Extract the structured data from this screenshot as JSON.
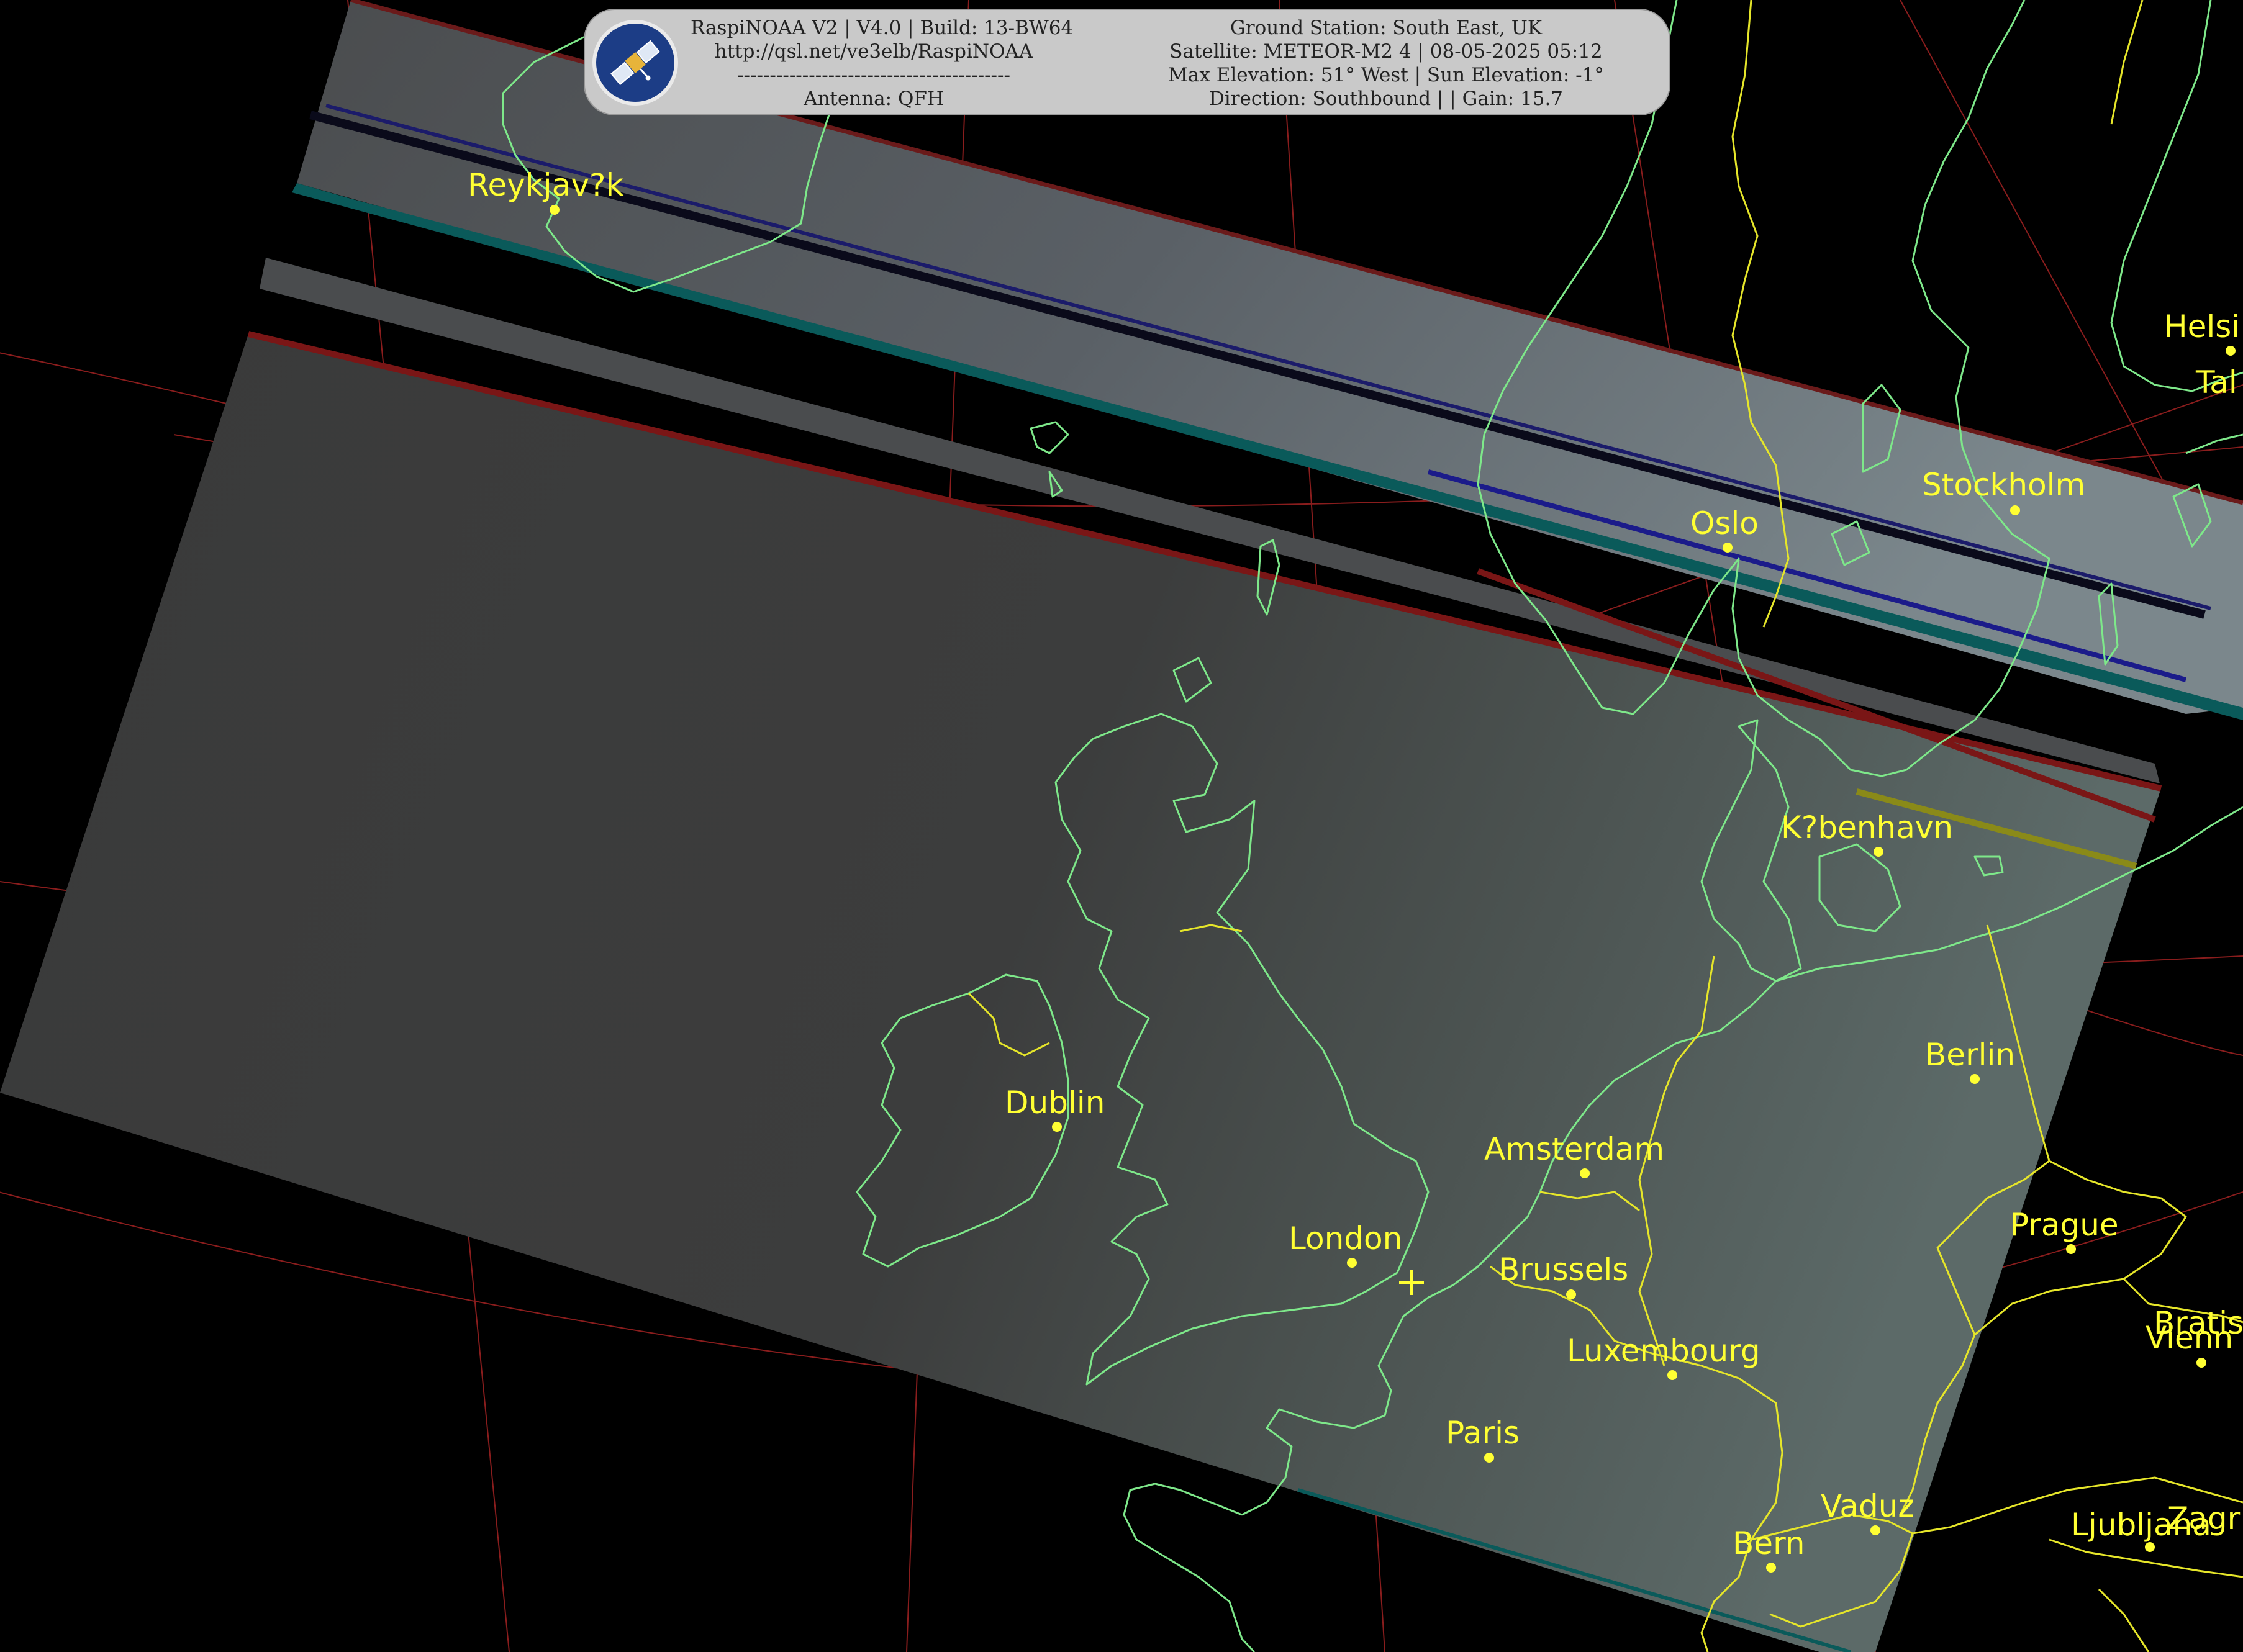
{
  "header": {
    "line1_left": "RaspiNOAA V2 | V4.0 | Build: 13-BW64",
    "line2_left": "http://qsl.net/ve3elb/RaspiNOAA",
    "line3_left": "------------------------------------------",
    "line4_left": "Antenna: QFH",
    "line1_right": "Ground Station: South East, UK",
    "line2_right": "Satellite: METEOR-M2 4 | 08-05-2025 05:12",
    "line3_right": "Max Elevation: 51° West | Sun Elevation: -1°",
    "line4_right": "Direction: Southbound | | Gain: 15.7",
    "logo_icon": "satellite-icon"
  },
  "cities": [
    {
      "name": "Reykjav?k"
    },
    {
      "name": "Helsi"
    },
    {
      "name": "Tal"
    },
    {
      "name": "Stockholm"
    },
    {
      "name": "Oslo"
    },
    {
      "name": "K?benhavn"
    },
    {
      "name": "Berlin"
    },
    {
      "name": "Dublin"
    },
    {
      "name": "Amsterdam"
    },
    {
      "name": "London"
    },
    {
      "name": "Brussels"
    },
    {
      "name": "Prague"
    },
    {
      "name": "Luxembourg"
    },
    {
      "name": "Bratis"
    },
    {
      "name": "Vienn"
    },
    {
      "name": "Paris"
    },
    {
      "name": "Vaduz"
    },
    {
      "name": "Bern"
    },
    {
      "name": "Zagr"
    },
    {
      "name": "Ljubljana"
    }
  ],
  "colors": {
    "coastline": "#7ee88a",
    "border": "#e6e62a",
    "city_label": "#ffff33",
    "graticule": "#8a1d1d",
    "no_data": "#3a3a3a"
  }
}
